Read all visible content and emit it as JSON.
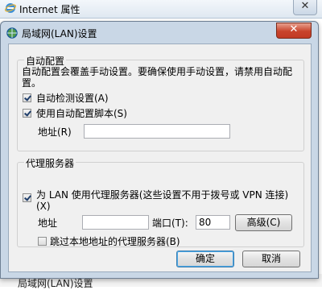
{
  "outer": {
    "title": "Internet 属性",
    "close_label": "✕",
    "bottom_text": "局域网(LAN)设置"
  },
  "dialog": {
    "title": "局域网(LAN)设置",
    "close_label": "✕"
  },
  "auto_config": {
    "legend": "自动配置",
    "description": "自动配置会覆盖手动设置。要确保使用手动设置，请禁用自动配置。",
    "detect_label": "自动检测设置(A)",
    "detect_checked": true,
    "script_label": "使用自动配置脚本(S)",
    "script_checked": true,
    "address_label": "地址(R)",
    "address_value": ""
  },
  "proxy": {
    "legend": "代理服务器",
    "use_proxy_label": "为 LAN 使用代理服务器(这些设置不用于拨号或 VPN 连接)",
    "use_proxy_label_line2": "(X)",
    "use_proxy_checked": true,
    "address_label": "地址",
    "address_value": "",
    "port_label": "端口(T):",
    "port_value": "80",
    "advanced_label": "高级(C)",
    "bypass_label": "跳过本地地址的代理服务器(B)",
    "bypass_checked": false
  },
  "buttons": {
    "ok_label": "确定",
    "cancel_label": "取消"
  }
}
